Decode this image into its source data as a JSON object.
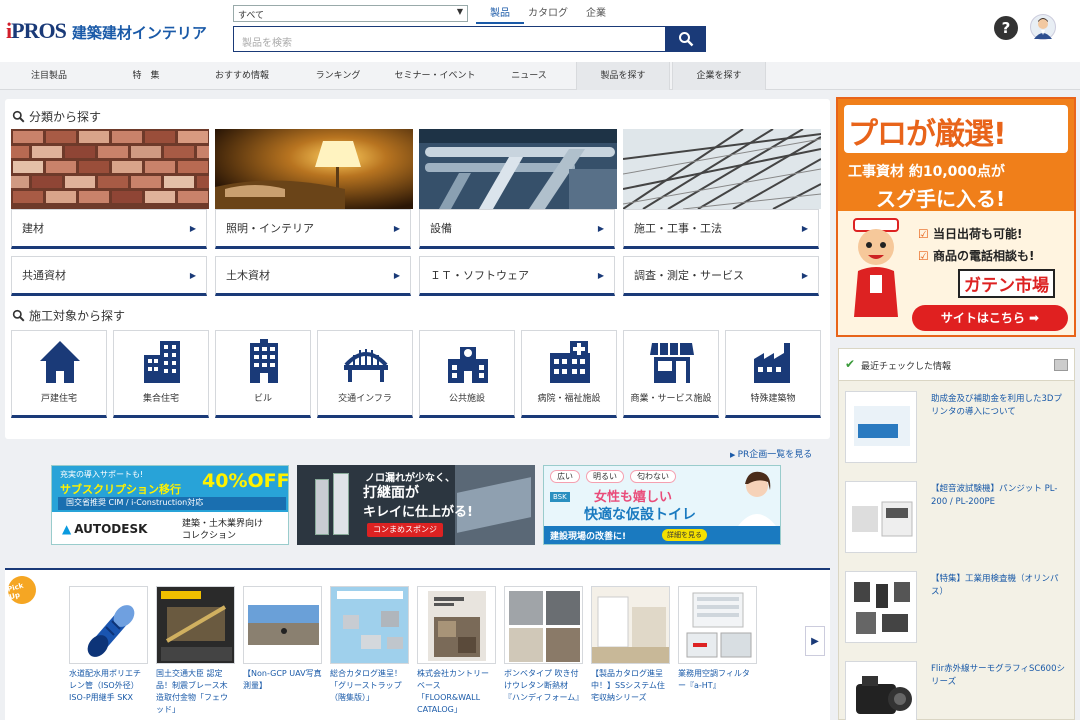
{
  "header": {
    "logo_text": "iPROS",
    "site_name": "建築建材インテリア",
    "scope_select": "すべて",
    "search_tabs": [
      "製品",
      "カタログ",
      "企業"
    ],
    "search_placeholder": "製品を検索",
    "help_label": "?"
  },
  "gnav": [
    "注目製品",
    "特　集",
    "おすすめ情報",
    "ランキング",
    "セミナー・イベント",
    "ニュース",
    "製品を探す",
    "企業を探す"
  ],
  "category": {
    "title": "分類から探す",
    "buttons": [
      "建材",
      "照明・インテリア",
      "設備",
      "施工・工事・工法",
      "共通資材",
      "土木資材",
      "ＩＴ・ソフトウェア",
      "調査・測定・サービス"
    ]
  },
  "target": {
    "title": "施工対象から探す",
    "items": [
      "戸建住宅",
      "集合住宅",
      "ビル",
      "交通インフラ",
      "公共施設",
      "病院・福祉施設",
      "商業・サービス施設",
      "特殊建築物"
    ]
  },
  "pr_link": "PR企画一覧を見る",
  "banners": {
    "b1": {
      "line1": "充実の導入サポートも!",
      "line2": "サブスクリプション移行",
      "off": "40%OFF",
      "line3": "国交省推奨 CIM / i-Construction対応",
      "brand": "AUTODESK",
      "line4": "建築・土木業界向け",
      "line5": "コレクション"
    },
    "b2": {
      "line1": "ノロ漏れが少なく、",
      "line2": "打継面が",
      "line3": "キレイに仕上がる!",
      "tag": "コンまめスポンジ"
    },
    "b3": {
      "tags": [
        "広い",
        "明るい",
        "匂わない"
      ],
      "brand": "BSK",
      "line1": "女性も嬉しい",
      "line2": "快適な仮設トイレ",
      "line3": "建設現場の改善に!",
      "btn": "詳細を見る"
    }
  },
  "pickup": {
    "badge": "Pick Up",
    "items": [
      "水道配水用ポリエチレン管（ISO外径）ISO-P用継手 SKX",
      "国土交通大臣 認定品！制震ブレース木造取付金物「フェウッド」",
      "【Non-GCP UAV写真測量】",
      "総合カタログ進呈！「グリーストラップ（階集版）」",
      "株式会社カントリーベース「FLOOR&WALL CATALOG」",
      "ボンベタイプ 吹き付けウレタン断熱材『ハンディフォーム』",
      "【製品カタログ進呈中！】SSシステム住宅収納シリーズ",
      "業務用空調フィルター『a-HT』"
    ]
  },
  "ad": {
    "line1": "プロが厳選!",
    "line2": "工事資材 約10,000点が",
    "line3": "スグ手に入る!",
    "check1": "当日出荷も可能!",
    "check2": "商品の電話相談も!",
    "brand": "ガテン市場",
    "btn": "サイトはこちら ➡"
  },
  "recent": {
    "title": "最近チェックした情報",
    "items": [
      "助成金及び補助金を利用した3Dプリンタの導入について",
      "【超音波試験機】パンジット PL-200 / PL-200PE",
      "【特集】工業用検査機（オリンパス）",
      "Flir赤外線サーモグラフィSC600シリーズ"
    ]
  },
  "colors": {
    "navy": "#1a3a78",
    "blue": "#1a5aa8",
    "orange": "#f07f1a",
    "red": "#d21f2b"
  }
}
